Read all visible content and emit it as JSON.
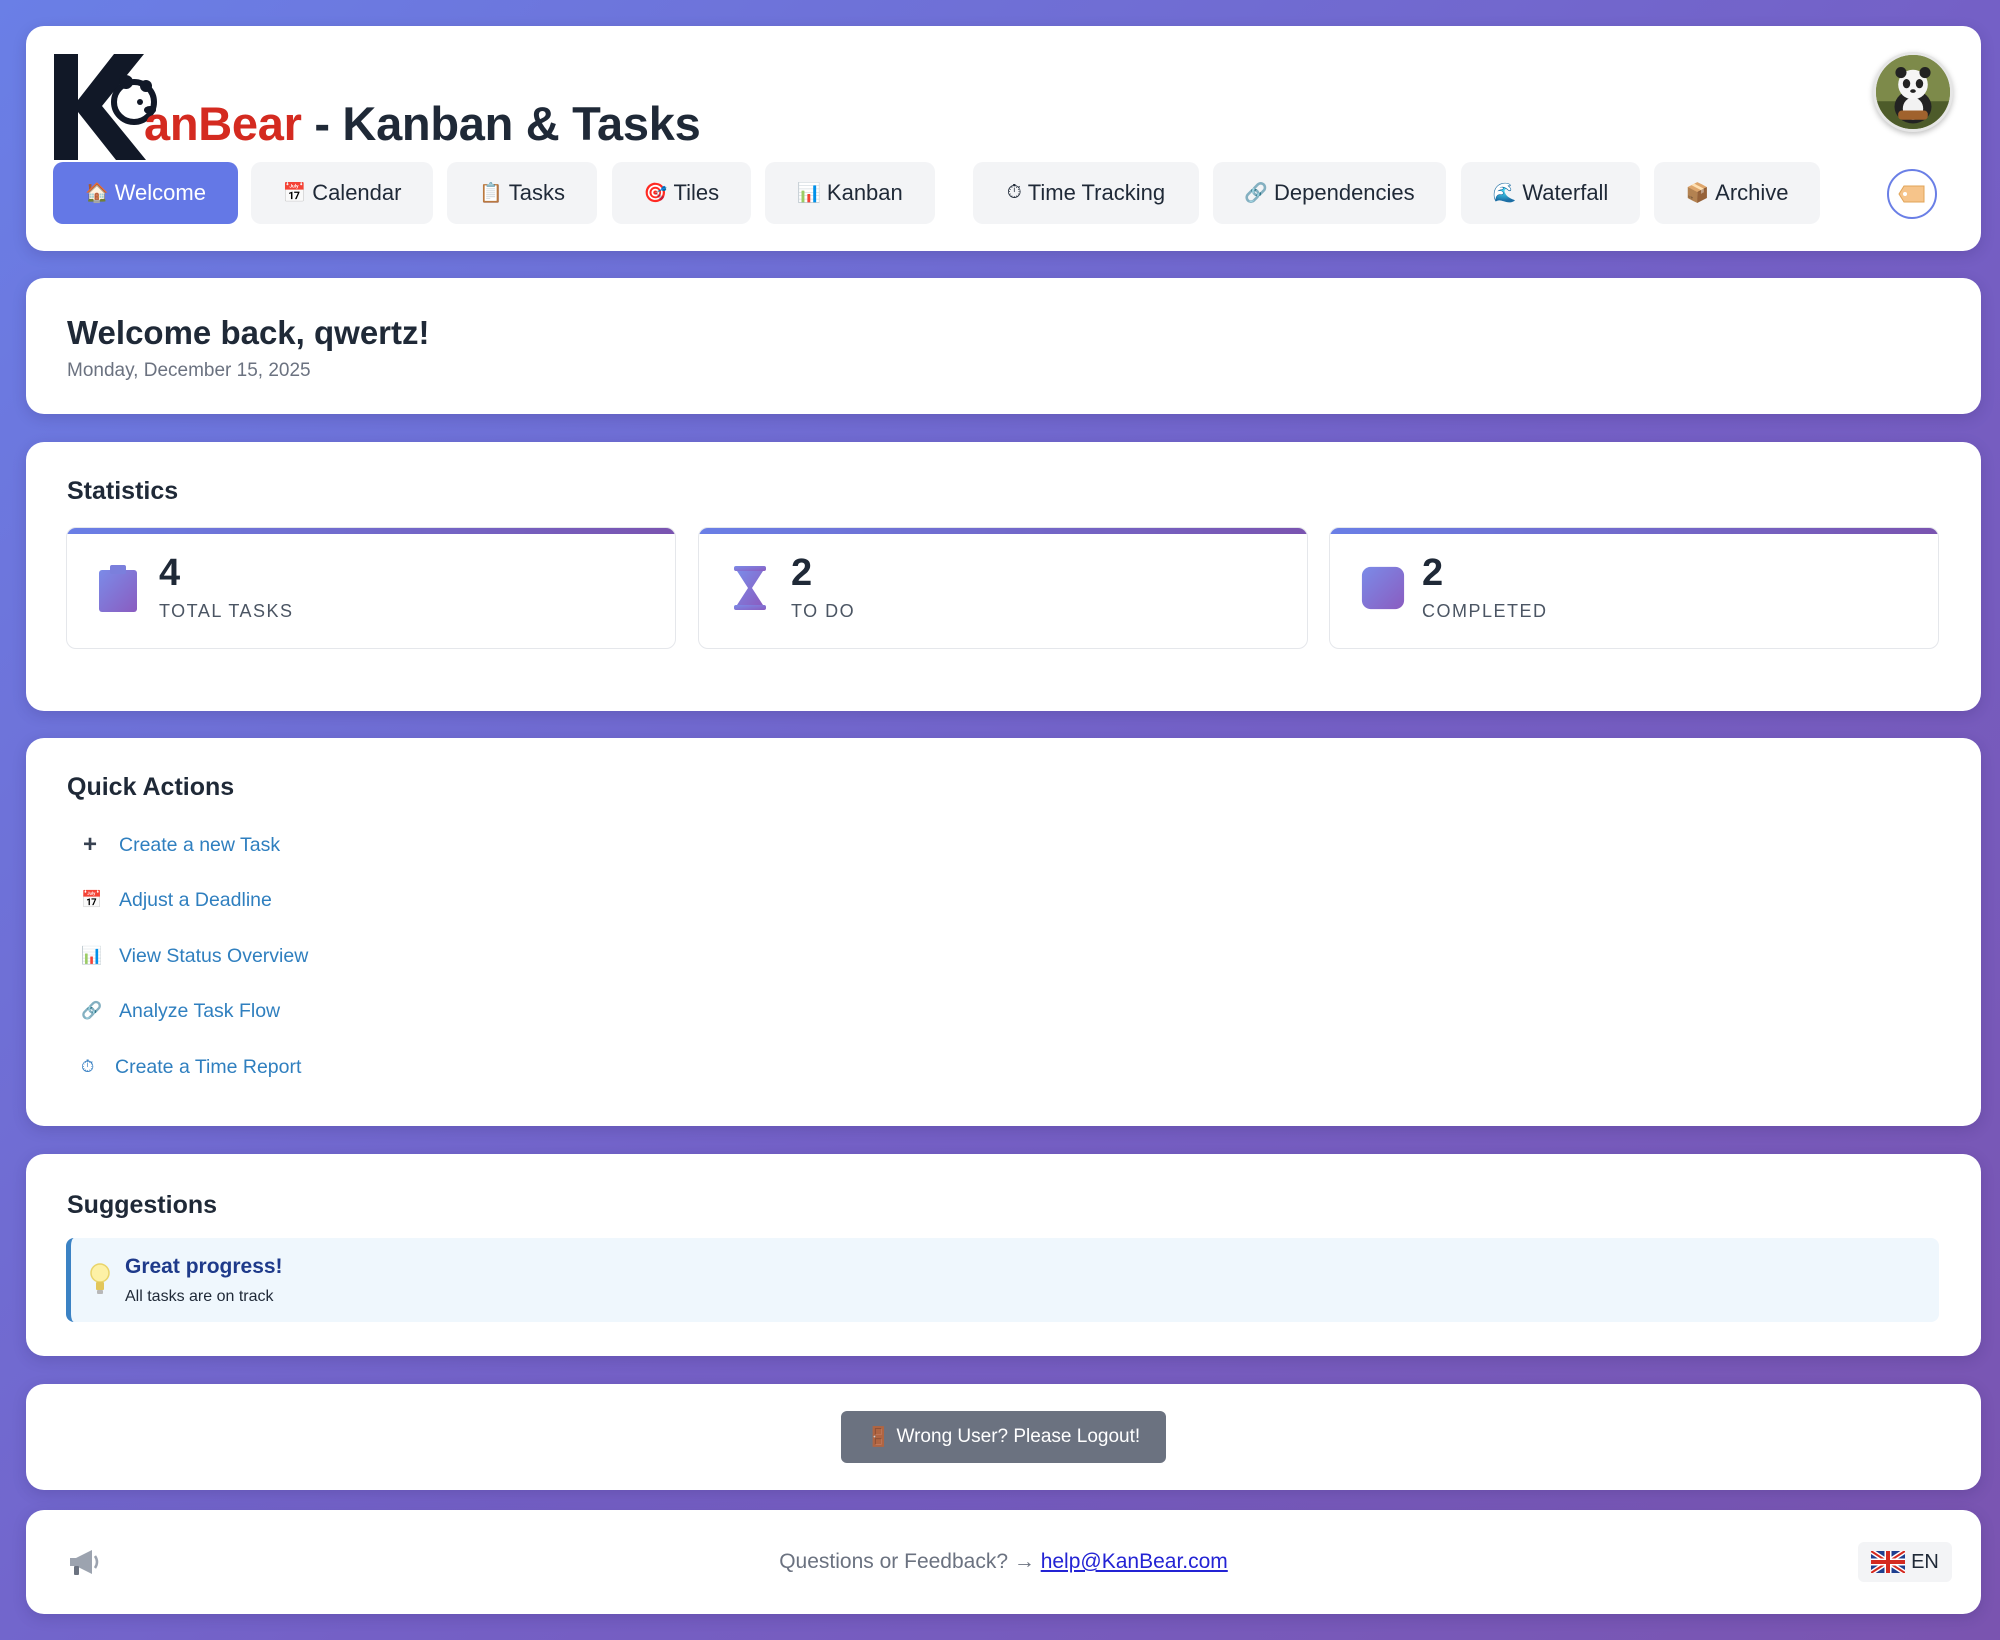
{
  "header": {
    "brand_part1": "anBear",
    "brand_part2": " - Kanban & Tasks",
    "nav": [
      {
        "icon": "🏠",
        "label": "Welcome",
        "active": true
      },
      {
        "icon": "📅",
        "label": "Calendar"
      },
      {
        "icon": "📋",
        "label": "Tasks"
      },
      {
        "icon": "🎯",
        "label": "Tiles"
      },
      {
        "icon": "📊",
        "label": "Kanban"
      },
      {
        "icon": "⏱",
        "label": "Time Tracking"
      },
      {
        "icon": "🔗",
        "label": "Dependencies"
      },
      {
        "icon": "🌊",
        "label": "Waterfall"
      },
      {
        "icon": "📦",
        "label": "Archive"
      }
    ]
  },
  "welcome": {
    "title": "Welcome back, qwertz!",
    "date": "Monday, December 15, 2025"
  },
  "stats": {
    "title": "Statistics",
    "items": [
      {
        "value": "4",
        "label": "TOTAL TASKS",
        "icon": "clipboard-icon"
      },
      {
        "value": "2",
        "label": "TO DO",
        "icon": "hourglass-icon"
      },
      {
        "value": "2",
        "label": "COMPLETED",
        "icon": "check-square-icon"
      }
    ]
  },
  "actions": {
    "title": "Quick Actions",
    "items": [
      {
        "icon": "+",
        "label": "Create a new Task"
      },
      {
        "icon": "📅",
        "label": "Adjust a Deadline"
      },
      {
        "icon": "📊",
        "label": "View Status Overview"
      },
      {
        "icon": "🔗",
        "label": "Analyze Task Flow"
      },
      {
        "icon": "⏱",
        "label": "Create a Time Report"
      }
    ]
  },
  "suggestions": {
    "title": "Suggestions",
    "item_title": "Great progress!",
    "item_text": "All tasks are on track"
  },
  "logout": {
    "icon": "🚪",
    "label": "Wrong User? Please Logout!"
  },
  "footer": {
    "question": "Questions or Feedback? → ",
    "email": "help@KanBear.com",
    "lang": "EN"
  },
  "colors": {
    "accent": "#6478e6",
    "brand_red": "#d42a20",
    "link": "#2f7fbf",
    "gradient_start": "#6a7fe6",
    "gradient_end": "#7a54b0"
  }
}
